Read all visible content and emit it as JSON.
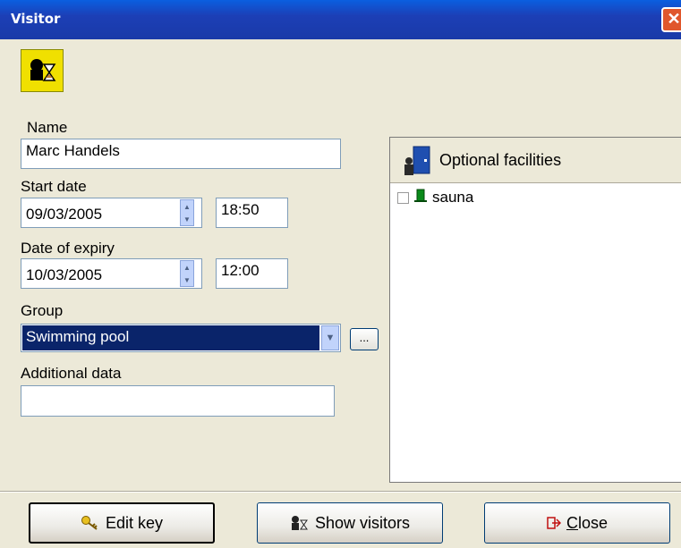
{
  "window": {
    "title": "Visitor",
    "close_glyph": "✕"
  },
  "form": {
    "name_label": "Name",
    "name_value": "Marc Handels",
    "start_date_label": "Start date",
    "start_date_value": "09/03/2005",
    "start_time_value": "18:50",
    "expiry_label": "Date of expiry",
    "expiry_date_value": "10/03/2005",
    "expiry_time_value": "12:00",
    "group_label": "Group",
    "group_value": "Swimming pool",
    "group_browse_label": "...",
    "additional_label": "Additional data",
    "additional_value": ""
  },
  "facilities": {
    "header": "Optional facilities",
    "items": [
      {
        "label": "sauna",
        "checked": false
      }
    ]
  },
  "buttons": {
    "edit_key": "Edit key",
    "show_visitors": "Show visitors",
    "close": "Close"
  },
  "icons": {
    "app": "visitor-hourglass-icon",
    "facilities_header": "door-person-icon",
    "facility_item": "green-door-icon",
    "edit_key": "key-icon",
    "show_visitors": "visitors-icon",
    "close": "exit-arrow-icon"
  },
  "colors": {
    "title_bar": "#1c3fb6",
    "selection": "#0a246a",
    "app_icon_bg": "#f0e000",
    "client_bg": "#ece9d8"
  }
}
